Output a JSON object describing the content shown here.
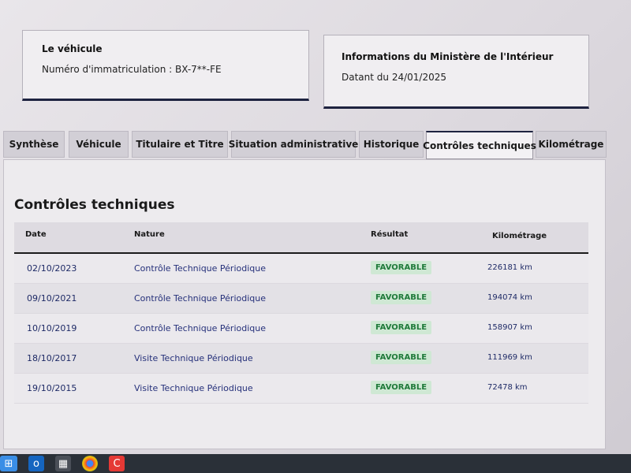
{
  "vehicle_card": {
    "title": "Le véhicule",
    "plate_text": "Numéro d'immatriculation : BX-7**-FE"
  },
  "ministry_card": {
    "title": "Informations du Ministère de l'Intérieur",
    "date_text": "Datant du 24/01/2025"
  },
  "tabs": [
    {
      "label": "Synthèse"
    },
    {
      "label": "Véhicule"
    },
    {
      "label": "Titulaire et Titre"
    },
    {
      "label": "Situation administrative"
    },
    {
      "label": "Historique"
    },
    {
      "label": "Contrôles techniques",
      "active": true
    },
    {
      "label": "Kilométrage"
    }
  ],
  "section": {
    "title": "Contrôles techniques"
  },
  "table": {
    "headers": {
      "date": "Date",
      "nature": "Nature",
      "result": "Résultat",
      "mileage": "Kilométrage"
    },
    "rows": [
      {
        "date": "02/10/2023",
        "nature": "Contrôle Technique Périodique",
        "result": "FAVORABLE",
        "mileage": "226181 km"
      },
      {
        "date": "09/10/2021",
        "nature": "Contrôle Technique Périodique",
        "result": "FAVORABLE",
        "mileage": "194074 km"
      },
      {
        "date": "10/10/2019",
        "nature": "Contrôle Technique Périodique",
        "result": "FAVORABLE",
        "mileage": "158907 km"
      },
      {
        "date": "18/10/2017",
        "nature": "Visite Technique Périodique",
        "result": "FAVORABLE",
        "mileage": "111969 km"
      },
      {
        "date": "19/10/2015",
        "nature": "Visite Technique Périodique",
        "result": "FAVORABLE",
        "mileage": "72478 km"
      }
    ]
  },
  "colors": {
    "accent_navy": "#1e2340",
    "favorable_bg": "#cfe8d4",
    "favorable_text": "#1f7a3a"
  },
  "taskbar": {
    "icons": [
      "windows-start-icon",
      "outlook-icon",
      "store-icon",
      "chrome-icon",
      "app-c-icon"
    ]
  }
}
